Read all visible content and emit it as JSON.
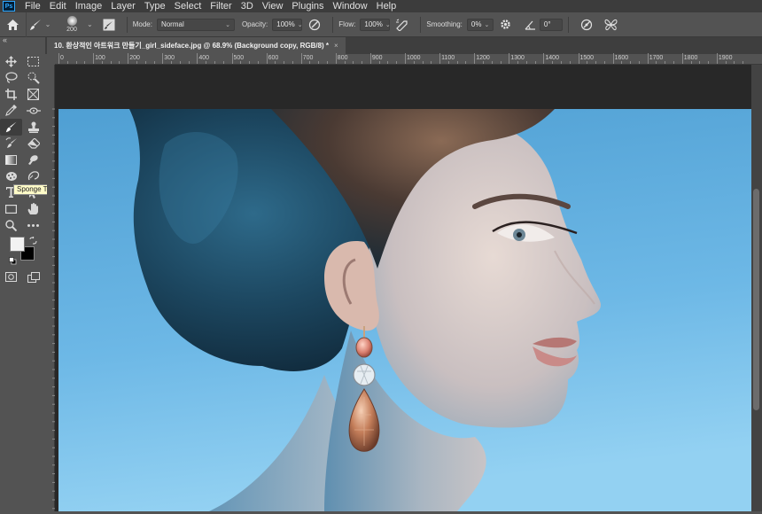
{
  "menu": [
    "File",
    "Edit",
    "Image",
    "Layer",
    "Type",
    "Select",
    "Filter",
    "3D",
    "View",
    "Plugins",
    "Window",
    "Help"
  ],
  "app_logo": "Ps",
  "options": {
    "brush_size": "200",
    "mode_label": "Mode:",
    "mode_value": "Normal",
    "opacity_label": "Opacity:",
    "opacity_value": "100%",
    "flow_label": "Flow:",
    "flow_value": "100%",
    "smoothing_label": "Smoothing:",
    "smoothing_value": "0%",
    "angle_value": "0°"
  },
  "collapse_glyph": "«",
  "document_tab": {
    "title": "10. 환상적인 아트워크 만들기_girl_sideface.jpg @ 68.9% (Background copy, RGB/8) *",
    "close": "×"
  },
  "ruler_labels": [
    "0",
    "100",
    "200",
    "300",
    "400",
    "500",
    "600",
    "700",
    "800",
    "900",
    "1000",
    "1100",
    "1200",
    "1300",
    "1400",
    "1500",
    "1600",
    "1700",
    "1800",
    "1900"
  ],
  "tooltip": "Sponge Tool (O)",
  "tools": [
    [
      "move-icon",
      "marquee-icon"
    ],
    [
      "lasso-icon",
      "quick-select-icon"
    ],
    [
      "crop-icon",
      "frame-icon"
    ],
    [
      "eyedropper-icon",
      "healing-icon"
    ],
    [
      "brush-icon",
      "stamp-icon"
    ],
    [
      "history-brush-icon",
      "eraser-icon"
    ],
    [
      "gradient-icon",
      "burn-icon"
    ],
    [
      "sponge-icon",
      "pen-icon"
    ],
    [
      "type-icon",
      "path-select-icon"
    ],
    [
      "rectangle-icon",
      "hand-icon"
    ],
    [
      "zoom-icon",
      "more-tools-icon"
    ]
  ],
  "colors": {
    "foreground": "#f2f2f2",
    "background": "#000000",
    "ps_blue": "#31a8ff",
    "photo_bg_top": "#5fa9d8",
    "photo_bg_bottom": "#8fcff0"
  }
}
